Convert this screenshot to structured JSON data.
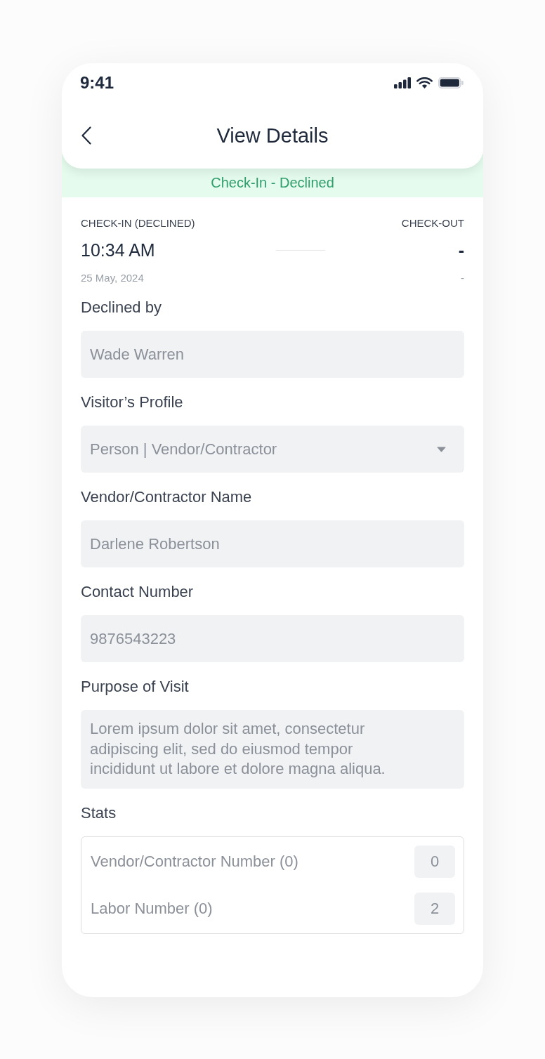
{
  "status_bar": {
    "time": "9:41"
  },
  "header": {
    "title": "View Details"
  },
  "status_banner": {
    "text": "Check-In - Declined"
  },
  "check_in": {
    "label": "CHECK-IN (DECLINED)",
    "time": "10:34 AM",
    "date": "25 May, 2024"
  },
  "check_out": {
    "label": "CHECK-OUT",
    "time": "-",
    "date": "-"
  },
  "fields": [
    {
      "kind": "text",
      "label": "Declined by",
      "value": "Wade Warren"
    },
    {
      "kind": "select",
      "label": "Visitor’s Profile",
      "value": "Person | Vendor/Contractor"
    },
    {
      "kind": "text",
      "label": "Vendor/Contractor Name",
      "value": "Darlene Robertson"
    },
    {
      "kind": "text",
      "label": "Contact Number",
      "value": "9876543223"
    },
    {
      "kind": "textarea",
      "label": "Purpose of Visit",
      "value": "Lorem ipsum dolor sit amet, consectetur adipiscing elit, sed do eiusmod tempor incididunt ut labore et dolore magna aliqua."
    }
  ],
  "stats": {
    "label": "Stats",
    "rows": [
      {
        "label": "Vendor/Contractor Number (0)",
        "value": "0"
      },
      {
        "label": "Labor Number (0)",
        "value": "2"
      }
    ]
  }
}
